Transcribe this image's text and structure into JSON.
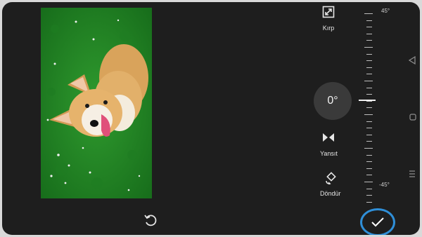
{
  "editor": {
    "angle": "0°",
    "tools": {
      "crop": {
        "label": "Kırp",
        "icon": "crop-icon"
      },
      "mirror": {
        "label": "Yansıt",
        "icon": "mirror-icon"
      },
      "rotate": {
        "label": "Döndür",
        "icon": "rotate-icon"
      }
    },
    "ruler": {
      "top_label": "45°",
      "bottom_label": "-45°"
    },
    "actions": {
      "reset_icon": "reset-icon",
      "confirm_icon": "check-icon"
    }
  },
  "accent_color": "#2f8fd8"
}
